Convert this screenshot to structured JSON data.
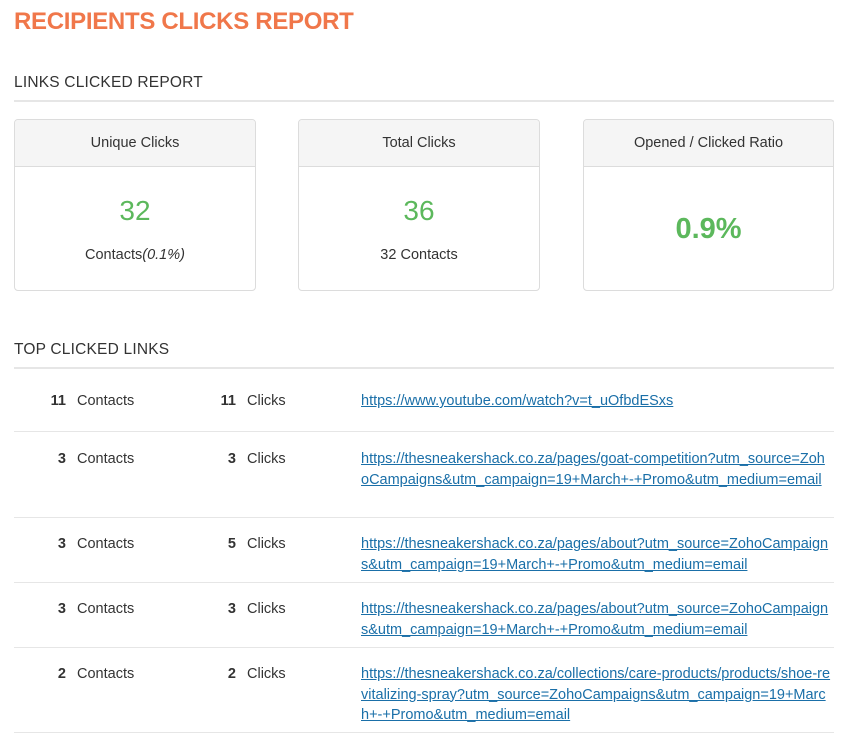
{
  "page_title": "RECIPIENTS CLICKS REPORT",
  "links_section_title": "LINKS CLICKED REPORT",
  "cards": [
    {
      "header": "Unique Clicks",
      "value": "32",
      "sub_text": "Contacts",
      "sub_italic": "(0.1%)"
    },
    {
      "header": "Total Clicks",
      "value": "36",
      "sub_count": "32",
      "sub_text": "Contacts"
    },
    {
      "header": "Opened / Clicked Ratio",
      "value": "0.9%"
    }
  ],
  "top_links_title": "TOP CLICKED LINKS",
  "top_links": [
    {
      "contacts": "11",
      "contacts_label": "Contacts",
      "clicks": "11",
      "clicks_label": "Clicks",
      "url": "https://www.youtube.com/watch?v=t_uOfbdESxs"
    },
    {
      "contacts": "3",
      "contacts_label": "Contacts",
      "clicks": "3",
      "clicks_label": "Clicks",
      "url": "https://thesneakershack.co.za/pages/goat-competition?utm_source=ZohoCampaigns&utm_campaign=19+March+-+Promo&utm_medium=email"
    },
    {
      "contacts": "3",
      "contacts_label": "Contacts",
      "clicks": "5",
      "clicks_label": "Clicks",
      "url": "https://thesneakershack.co.za/pages/about?utm_source=ZohoCampaigns&utm_campaign=19+March+-+Promo&utm_medium=email"
    },
    {
      "contacts": "3",
      "contacts_label": "Contacts",
      "clicks": "3",
      "clicks_label": "Clicks",
      "url": "https://thesneakershack.co.za/pages/about?utm_source=ZohoCampaigns&utm_campaign=19+March+-+Promo&utm_medium=email"
    },
    {
      "contacts": "2",
      "contacts_label": "Contacts",
      "clicks": "2",
      "clicks_label": "Clicks",
      "url": "https://thesneakershack.co.za/collections/care-products/products/shoe-revitalizing-spray?utm_source=ZohoCampaigns&utm_campaign=19+March+-+Promo&utm_medium=email"
    }
  ],
  "colors": {
    "title": "#f0774a",
    "value": "#5cb85c",
    "link": "#1a6fa8"
  }
}
